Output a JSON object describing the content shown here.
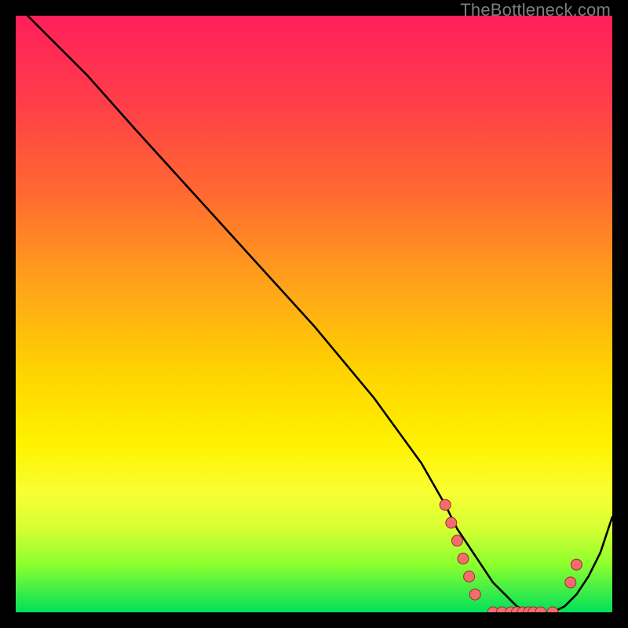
{
  "watermark": "TheBottleneck.com",
  "chart_data": {
    "type": "line",
    "title": "",
    "xlabel": "",
    "ylabel": "",
    "xlim": [
      0,
      100
    ],
    "ylim": [
      0,
      100
    ],
    "grid": false,
    "series": [
      {
        "name": "curve",
        "color": "#000000",
        "x": [
          2,
          6,
          12,
          20,
          30,
          40,
          50,
          60,
          68,
          72,
          74,
          76,
          78,
          80,
          82,
          84,
          86,
          88,
          90,
          92,
          94,
          96,
          98,
          100
        ],
        "y": [
          100,
          96,
          90,
          81,
          70,
          59,
          48,
          36,
          25,
          18,
          14,
          11,
          8,
          5,
          3,
          1,
          0,
          0,
          0,
          1,
          3,
          6,
          10,
          16
        ]
      }
    ],
    "markers": [
      {
        "x": 72.0,
        "y": 18
      },
      {
        "x": 73.0,
        "y": 15
      },
      {
        "x": 74.0,
        "y": 12
      },
      {
        "x": 75.0,
        "y": 9
      },
      {
        "x": 76.0,
        "y": 6
      },
      {
        "x": 77.0,
        "y": 3
      },
      {
        "x": 80.0,
        "y": 0
      },
      {
        "x": 81.5,
        "y": 0
      },
      {
        "x": 83.0,
        "y": 0
      },
      {
        "x": 84.0,
        "y": 0
      },
      {
        "x": 85.0,
        "y": 0
      },
      {
        "x": 86.0,
        "y": 0
      },
      {
        "x": 86.8,
        "y": 0
      },
      {
        "x": 88.0,
        "y": 0
      },
      {
        "x": 90.0,
        "y": 0
      },
      {
        "x": 93.0,
        "y": 5
      },
      {
        "x": 94.0,
        "y": 8
      }
    ],
    "marker_style": {
      "fill": "#f26d6d",
      "stroke": "#9c2b2b",
      "radius": 7
    },
    "background_gradient": {
      "top": "#ff1f5a",
      "mid1": "#ffa31a",
      "mid2": "#fff200",
      "bottom": "#00e05a"
    }
  }
}
